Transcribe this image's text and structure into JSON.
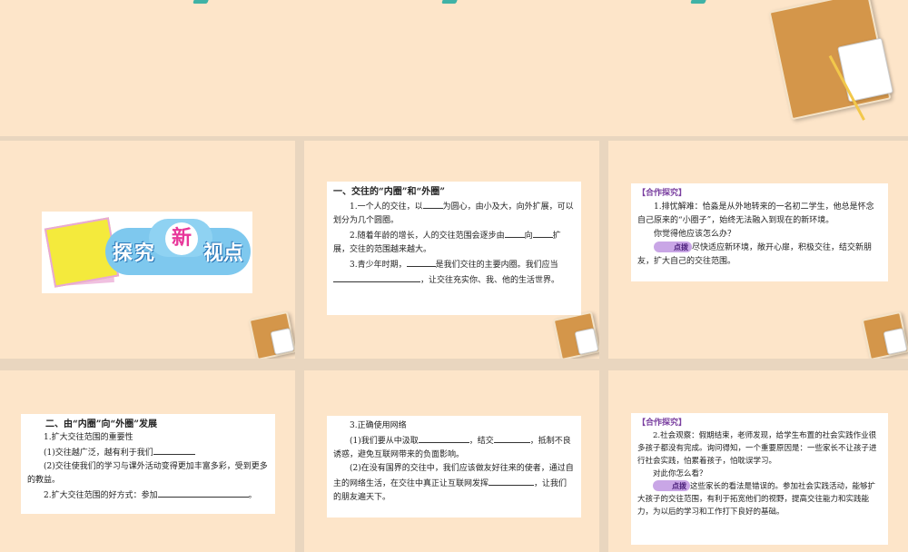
{
  "slide1": {
    "badge": "探究",
    "new_char": "新",
    "suffix": "视点"
  },
  "slide2": {
    "heading": "一、交往的“内圈”和“外圈”",
    "p1a": "1.一个人的交往，以",
    "p1b": "为圆心，由小及大，向外扩展，可以划分为几个圆圈。",
    "p2a": "2.随着年龄的增长，人的交往范围会逐步由",
    "p2b": "向",
    "p2c": "扩展，交往的范围越来越大。",
    "p3a": "3.青少年时期，",
    "p3b": "是我们交往的主要内圈。我们应当",
    "p3c": "，让交往充实你、我、他的生活世界。"
  },
  "slide3": {
    "tag": "【合作探究】",
    "p1": "1.排忧解难：恰淼是从外地转来的一名初二学生，他总是怀念自己原来的“小圈子”，始终无法融入到现在的新环境。",
    "q": "你觉得他应该怎么办？",
    "hint": "点拨",
    "answer": "尽快适应新环境，敞开心扉，积极交往，结交新朋友，扩大自己的交往范围。"
  },
  "slide4": {
    "heading": "二、由“内圈”向“外圈”发展",
    "p1": "1.扩大交往范围的重要性",
    "p2": "(1)交往越广泛，越有利于我们",
    "p3": "(2)交往使我们的学习与课外活动变得更加丰富多彩，受到更多的教益。",
    "p4": "2.扩大交往范围的好方式：参加",
    "p4end": "。"
  },
  "slide5": {
    "heading": "3.正确使用网络",
    "p1a": "(1)我们要从中汲取",
    "p1b": "，结交",
    "p1c": "，抵制不良诱惑，避免互联网带来的负面影响。",
    "p2a": "(2)在没有国界的交往中，我们应该做友好往来的使者，通过自主的网络生活，在交往中真正让互联网发挥",
    "p2b": "，让我们的朋友遍天下。"
  },
  "slide6": {
    "tag": "【合作探究】",
    "p1": "2.社会观察：假期结束，老师发现，给学生布置的社会实践作业很多孩子都没有完成。询问得知，一个重要原因是：一些家长不让孩子进行社会实践，怕累着孩子，怕耽误学习。",
    "q": "对此你怎么看？",
    "hint": "点拨",
    "answer": "这些家长的看法是错误的。参加社会实践活动，能够扩大孩子的交往范围，有利于拓宽他们的视野，提高交往能力和实践能力，为以后的学习和工作打下良好的基础。"
  }
}
